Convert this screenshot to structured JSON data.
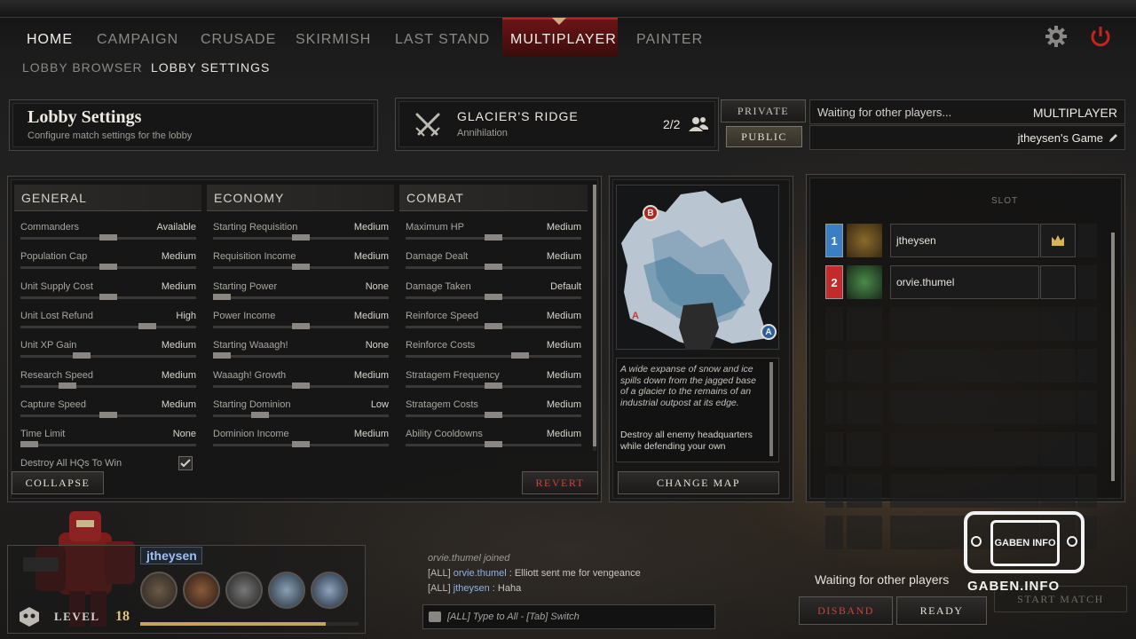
{
  "nav": {
    "items": [
      "HOME",
      "CAMPAIGN",
      "CRUSADE",
      "SKIRMISH",
      "LAST STAND",
      "MULTIPLAYER",
      "PAINTER"
    ],
    "active": "MULTIPLAYER",
    "sub": [
      "LOBBY BROWSER",
      "LOBBY SETTINGS"
    ],
    "settings_icon": "gear-icon",
    "power_icon": "power-icon"
  },
  "header": {
    "title": "Lobby Settings",
    "subtitle": "Configure match settings for the lobby"
  },
  "map_info": {
    "name": "GLACIER'S RIDGE",
    "mode": "Annihilation",
    "players": "2/2",
    "icon": "crossed-swords-icon"
  },
  "privacy": {
    "private_label": "PRIVATE",
    "public_label": "PUBLIC",
    "selected": "PUBLIC"
  },
  "status": {
    "waiting": "Waiting for other players...",
    "mode": "MULTIPLAYER",
    "game_name": "jtheysen's Game"
  },
  "general": {
    "heading": "GENERAL",
    "rows": [
      {
        "label": "Commanders",
        "value": "Available",
        "level": 0.5
      },
      {
        "label": "Population Cap",
        "value": "Medium",
        "level": 0.5
      },
      {
        "label": "Unit Supply Cost",
        "value": "Medium",
        "level": 0.5
      },
      {
        "label": "Unit Lost Refund",
        "value": "High",
        "level": 0.72
      },
      {
        "label": "Unit XP Gain",
        "value": "Medium",
        "level": 0.35
      },
      {
        "label": "Research Speed",
        "value": "Medium",
        "level": 0.27
      },
      {
        "label": "Capture Speed",
        "value": "Medium",
        "level": 0.5
      },
      {
        "label": "Time Limit",
        "value": "None",
        "level": 0.05
      }
    ],
    "checkbox_label": "Destroy All HQs To Win",
    "checkbox_checked": true
  },
  "economy": {
    "heading": "ECONOMY",
    "rows": [
      {
        "label": "Starting Requisition",
        "value": "Medium",
        "level": 0.5
      },
      {
        "label": "Requisition Income",
        "value": "Medium",
        "level": 0.5
      },
      {
        "label": "Starting Power",
        "value": "None",
        "level": 0.05
      },
      {
        "label": "Power Income",
        "value": "Medium",
        "level": 0.5
      },
      {
        "label": "Starting Waaagh!",
        "value": "None",
        "level": 0.05
      },
      {
        "label": "Waaagh! Growth",
        "value": "Medium",
        "level": 0.5
      },
      {
        "label": "Starting Dominion",
        "value": "Low",
        "level": 0.27
      },
      {
        "label": "Dominion Income",
        "value": "Medium",
        "level": 0.5
      }
    ]
  },
  "combat": {
    "heading": "COMBAT",
    "rows": [
      {
        "label": "Maximum HP",
        "value": "Medium",
        "level": 0.5
      },
      {
        "label": "Damage Dealt",
        "value": "Medium",
        "level": 0.5
      },
      {
        "label": "Damage Taken",
        "value": "Default",
        "level": 0.5
      },
      {
        "label": "Reinforce Speed",
        "value": "Medium",
        "level": 0.5
      },
      {
        "label": "Reinforce Costs",
        "value": "Medium",
        "level": 0.65
      },
      {
        "label": "Stratagem Frequency",
        "value": "Medium",
        "level": 0.5
      },
      {
        "label": "Stratagem Costs",
        "value": "Medium",
        "level": 0.5
      },
      {
        "label": "Ability Cooldowns",
        "value": "Medium",
        "level": 0.5
      }
    ]
  },
  "buttons": {
    "collapse": "COLLAPSE",
    "revert": "REVERT",
    "change_map": "CHANGE MAP",
    "disband": "DISBAND",
    "ready": "READY",
    "start_match": "START MATCH"
  },
  "map": {
    "markers": [
      "B",
      "A",
      "A"
    ],
    "description": "A wide expanse of snow and ice spills down from the jagged base of a glacier to the remains of an industrial outpost at its edge.",
    "objective": "Destroy all enemy headquarters while defending your own"
  },
  "slots": {
    "heading": "SLOT",
    "players": [
      {
        "number": "1",
        "name": "jtheysen",
        "team_color": "#3a7fc4",
        "crown": true
      },
      {
        "number": "2",
        "name": "orvie.thumel",
        "team_color": "#c42a2a",
        "crown": false
      }
    ]
  },
  "profile": {
    "name": "jtheysen",
    "level_label": "LEVEL",
    "level": "18",
    "xp_progress": 0.85
  },
  "chat": {
    "lines": [
      {
        "prefix": "",
        "name": "orvie.thumel",
        "text": " joined",
        "italic": true
      },
      {
        "prefix": "[ALL] ",
        "name": "orvie.thumel",
        "text": " : Elliott sent me for vengeance",
        "italic": false
      },
      {
        "prefix": "[ALL] ",
        "name": "jtheysen",
        "text": " : Haha",
        "italic": false
      }
    ],
    "input_placeholder": "[ALL] Type to All - [Tab] Switch"
  },
  "footer_status": "Waiting for other players",
  "watermark": {
    "logo_text": "GABEN INFO",
    "site": "GABEN.INFO"
  }
}
